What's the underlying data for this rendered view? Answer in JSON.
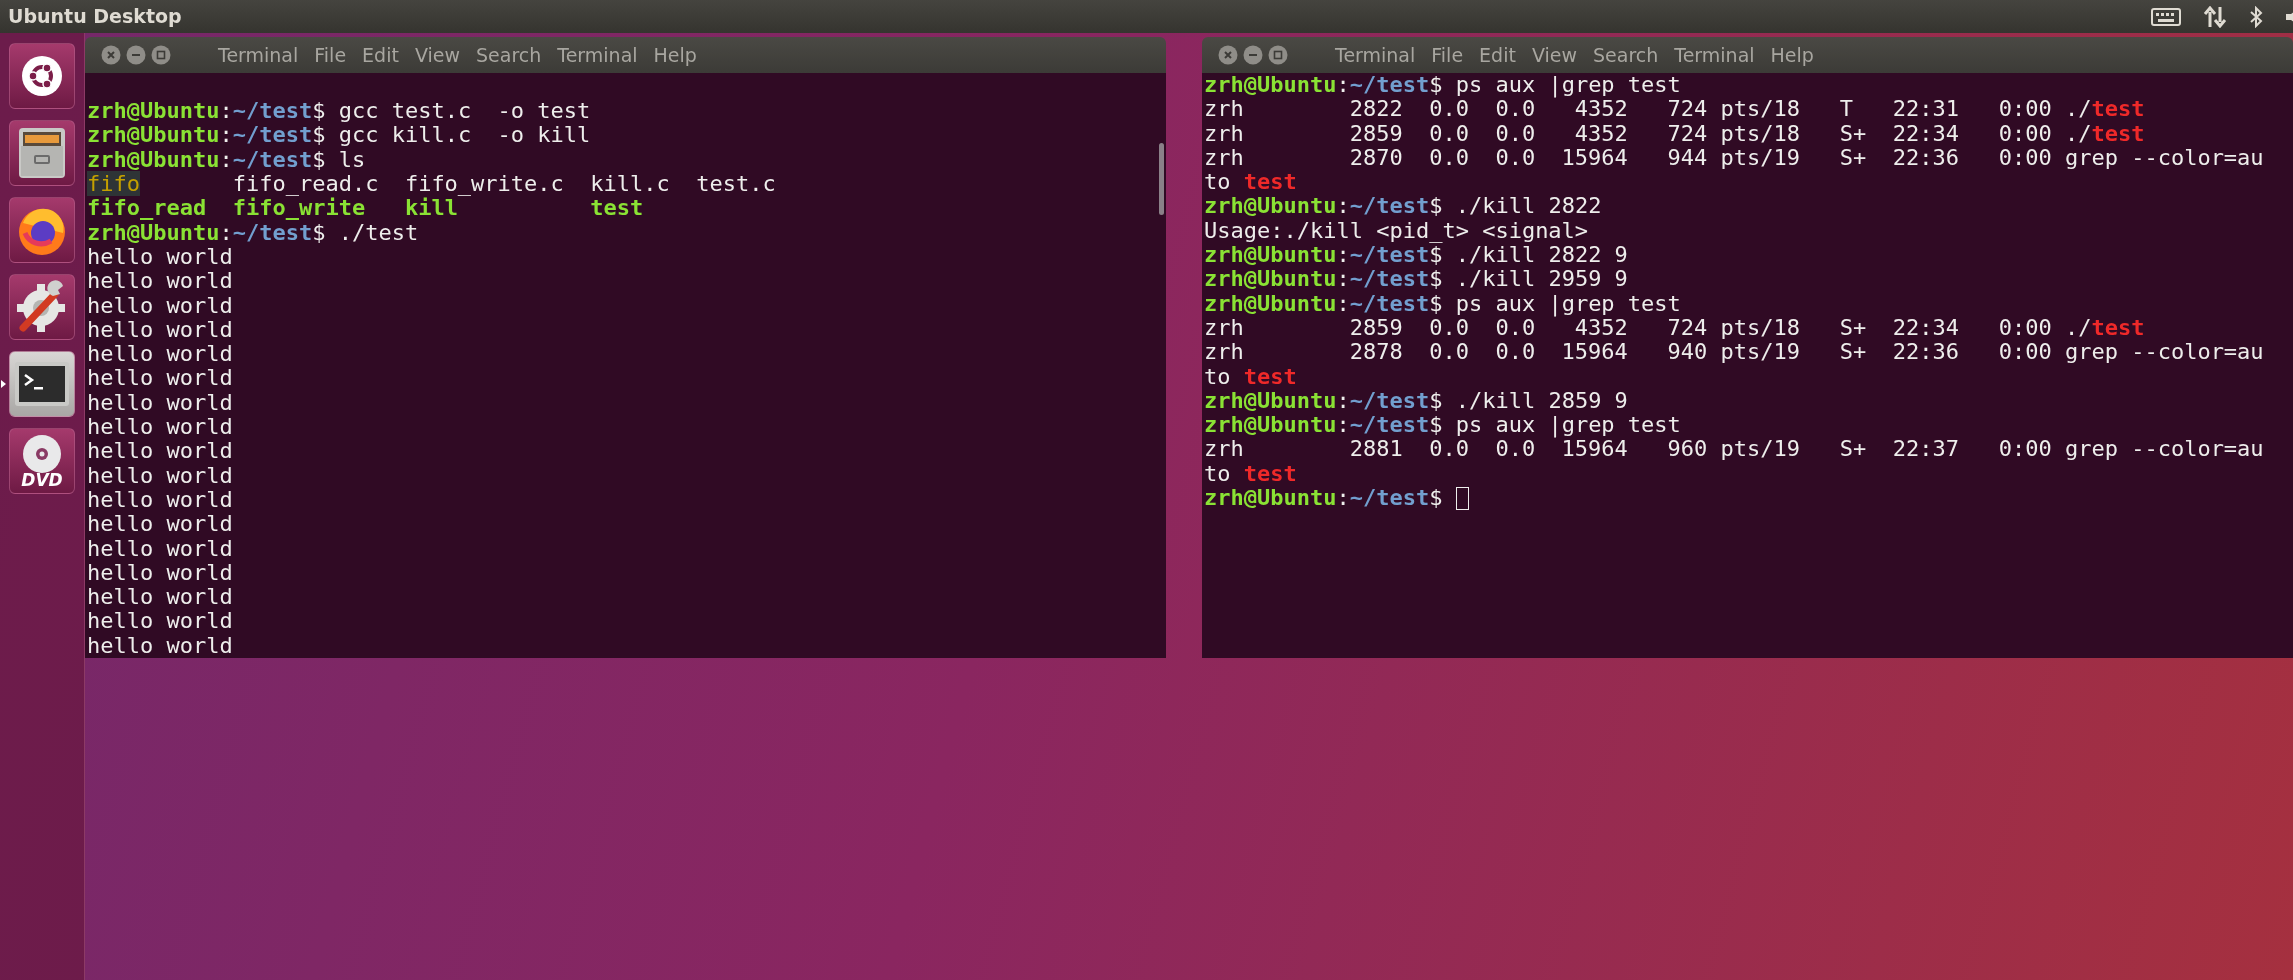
{
  "top_bar": {
    "title": "Ubuntu Desktop",
    "indicators": [
      {
        "kind": "keyboard"
      },
      {
        "kind": "network"
      },
      {
        "kind": "bluetooth"
      },
      {
        "kind": "volume"
      }
    ]
  },
  "launcher": {
    "items": [
      {
        "kind": "home",
        "running": false
      },
      {
        "kind": "files",
        "running": false
      },
      {
        "kind": "browser",
        "running": false
      },
      {
        "kind": "settings",
        "running": false
      },
      {
        "kind": "terminal",
        "running": true
      },
      {
        "kind": "dvd",
        "running": false,
        "label": "DVD"
      }
    ]
  },
  "windows": [
    {
      "menu": [
        "Terminal",
        "File",
        "Edit",
        "View",
        "Search",
        "Terminal",
        "Help"
      ],
      "scrollbar": true,
      "lines": [
        {
          "cursor": false,
          "segments": [
            {
              "kind": "user",
              "text": "zrh@Ubuntu"
            },
            {
              "kind": "plain",
              "text": ":"
            },
            {
              "kind": "path",
              "text": "~/test"
            },
            {
              "kind": "plain",
              "text": "$ gcc test.c  -o test"
            }
          ]
        },
        {
          "cursor": false,
          "segments": [
            {
              "kind": "user",
              "text": "zrh@Ubuntu"
            },
            {
              "kind": "plain",
              "text": ":"
            },
            {
              "kind": "path",
              "text": "~/test"
            },
            {
              "kind": "plain",
              "text": "$ gcc kill.c  -o kill"
            }
          ]
        },
        {
          "cursor": false,
          "segments": [
            {
              "kind": "user",
              "text": "zrh@Ubuntu"
            },
            {
              "kind": "plain",
              "text": ":"
            },
            {
              "kind": "path",
              "text": "~/test"
            },
            {
              "kind": "plain",
              "text": "$ ls"
            }
          ]
        },
        {
          "cursor": false,
          "segments": [
            {
              "kind": "pipe",
              "text": "fifo"
            },
            {
              "kind": "plain",
              "text": "       fifo_read.c  fifo_write.c  kill.c  test.c"
            }
          ]
        },
        {
          "cursor": false,
          "segments": [
            {
              "kind": "exec",
              "text": "fifo_read  "
            },
            {
              "kind": "exec",
              "text": "fifo_write   "
            },
            {
              "kind": "exec",
              "text": "kill          "
            },
            {
              "kind": "exec",
              "text": "test"
            }
          ]
        },
        {
          "cursor": false,
          "segments": [
            {
              "kind": "user",
              "text": "zrh@Ubuntu"
            },
            {
              "kind": "plain",
              "text": ":"
            },
            {
              "kind": "path",
              "text": "~/test"
            },
            {
              "kind": "plain",
              "text": "$ ./test"
            }
          ]
        },
        {
          "cursor": false,
          "segments": [
            {
              "kind": "plain",
              "text": "hello world"
            }
          ]
        },
        {
          "cursor": false,
          "segments": [
            {
              "kind": "plain",
              "text": "hello world"
            }
          ]
        },
        {
          "cursor": false,
          "segments": [
            {
              "kind": "plain",
              "text": "hello world"
            }
          ]
        },
        {
          "cursor": false,
          "segments": [
            {
              "kind": "plain",
              "text": "hello world"
            }
          ]
        },
        {
          "cursor": false,
          "segments": [
            {
              "kind": "plain",
              "text": "hello world"
            }
          ]
        },
        {
          "cursor": false,
          "segments": [
            {
              "kind": "plain",
              "text": "hello world"
            }
          ]
        },
        {
          "cursor": false,
          "segments": [
            {
              "kind": "plain",
              "text": "hello world"
            }
          ]
        },
        {
          "cursor": false,
          "segments": [
            {
              "kind": "plain",
              "text": "hello world"
            }
          ]
        },
        {
          "cursor": false,
          "segments": [
            {
              "kind": "plain",
              "text": "hello world"
            }
          ]
        },
        {
          "cursor": false,
          "segments": [
            {
              "kind": "plain",
              "text": "hello world"
            }
          ]
        },
        {
          "cursor": false,
          "segments": [
            {
              "kind": "plain",
              "text": "hello world"
            }
          ]
        },
        {
          "cursor": false,
          "segments": [
            {
              "kind": "plain",
              "text": "hello world"
            }
          ]
        },
        {
          "cursor": false,
          "segments": [
            {
              "kind": "plain",
              "text": "hello world"
            }
          ]
        },
        {
          "cursor": false,
          "segments": [
            {
              "kind": "plain",
              "text": "hello world"
            }
          ]
        },
        {
          "cursor": false,
          "segments": [
            {
              "kind": "plain",
              "text": "hello world"
            }
          ]
        },
        {
          "cursor": false,
          "segments": [
            {
              "kind": "plain",
              "text": "hello world"
            }
          ]
        },
        {
          "cursor": false,
          "segments": [
            {
              "kind": "plain",
              "text": "hello world"
            }
          ]
        }
      ]
    },
    {
      "menu": [
        "Terminal",
        "File",
        "Edit",
        "View",
        "Search",
        "Terminal",
        "Help"
      ],
      "scrollbar": false,
      "lines": [
        {
          "cursor": false,
          "segments": [
            {
              "kind": "user",
              "text": "zrh@Ubuntu"
            },
            {
              "kind": "plain",
              "text": ":"
            },
            {
              "kind": "path",
              "text": "~/test"
            },
            {
              "kind": "plain",
              "text": "$ ps aux |grep test"
            }
          ]
        },
        {
          "cursor": false,
          "segments": [
            {
              "kind": "plain",
              "text": "zrh        2822  0.0  0.0   4352   724 pts/18   T   22:31   0:00 ./"
            },
            {
              "kind": "match",
              "text": "test"
            }
          ]
        },
        {
          "cursor": false,
          "segments": [
            {
              "kind": "plain",
              "text": "zrh        2859  0.0  0.0   4352   724 pts/18   S+  22:34   0:00 ./"
            },
            {
              "kind": "match",
              "text": "test"
            }
          ]
        },
        {
          "cursor": false,
          "segments": [
            {
              "kind": "plain",
              "text": "zrh        2870  0.0  0.0  15964   944 pts/19   S+  22:36   0:00 grep --color=au"
            }
          ]
        },
        {
          "cursor": false,
          "segments": [
            {
              "kind": "plain",
              "text": "to "
            },
            {
              "kind": "match",
              "text": "test"
            }
          ]
        },
        {
          "cursor": false,
          "segments": [
            {
              "kind": "user",
              "text": "zrh@Ubuntu"
            },
            {
              "kind": "plain",
              "text": ":"
            },
            {
              "kind": "path",
              "text": "~/test"
            },
            {
              "kind": "plain",
              "text": "$ ./kill 2822"
            }
          ]
        },
        {
          "cursor": false,
          "segments": [
            {
              "kind": "plain",
              "text": "Usage:./kill <pid_t> <signal>"
            }
          ]
        },
        {
          "cursor": false,
          "segments": [
            {
              "kind": "user",
              "text": "zrh@Ubuntu"
            },
            {
              "kind": "plain",
              "text": ":"
            },
            {
              "kind": "path",
              "text": "~/test"
            },
            {
              "kind": "plain",
              "text": "$ ./kill 2822 9"
            }
          ]
        },
        {
          "cursor": false,
          "segments": [
            {
              "kind": "user",
              "text": "zrh@Ubuntu"
            },
            {
              "kind": "plain",
              "text": ":"
            },
            {
              "kind": "path",
              "text": "~/test"
            },
            {
              "kind": "plain",
              "text": "$ ./kill 2959 9"
            }
          ]
        },
        {
          "cursor": false,
          "segments": [
            {
              "kind": "user",
              "text": "zrh@Ubuntu"
            },
            {
              "kind": "plain",
              "text": ":"
            },
            {
              "kind": "path",
              "text": "~/test"
            },
            {
              "kind": "plain",
              "text": "$ ps aux |grep test"
            }
          ]
        },
        {
          "cursor": false,
          "segments": [
            {
              "kind": "plain",
              "text": "zrh        2859  0.0  0.0   4352   724 pts/18   S+  22:34   0:00 ./"
            },
            {
              "kind": "match",
              "text": "test"
            }
          ]
        },
        {
          "cursor": false,
          "segments": [
            {
              "kind": "plain",
              "text": "zrh        2878  0.0  0.0  15964   940 pts/19   S+  22:36   0:00 grep --color=au"
            }
          ]
        },
        {
          "cursor": false,
          "segments": [
            {
              "kind": "plain",
              "text": "to "
            },
            {
              "kind": "match",
              "text": "test"
            }
          ]
        },
        {
          "cursor": false,
          "segments": [
            {
              "kind": "user",
              "text": "zrh@Ubuntu"
            },
            {
              "kind": "plain",
              "text": ":"
            },
            {
              "kind": "path",
              "text": "~/test"
            },
            {
              "kind": "plain",
              "text": "$ ./kill 2859 9"
            }
          ]
        },
        {
          "cursor": false,
          "segments": [
            {
              "kind": "user",
              "text": "zrh@Ubuntu"
            },
            {
              "kind": "plain",
              "text": ":"
            },
            {
              "kind": "path",
              "text": "~/test"
            },
            {
              "kind": "plain",
              "text": "$ ps aux |grep test"
            }
          ]
        },
        {
          "cursor": false,
          "segments": [
            {
              "kind": "plain",
              "text": "zrh        2881  0.0  0.0  15964   960 pts/19   S+  22:37   0:00 grep --color=au"
            }
          ]
        },
        {
          "cursor": false,
          "segments": [
            {
              "kind": "plain",
              "text": "to "
            },
            {
              "kind": "match",
              "text": "test"
            }
          ]
        },
        {
          "cursor": true,
          "segments": [
            {
              "kind": "user",
              "text": "zrh@Ubuntu"
            },
            {
              "kind": "plain",
              "text": ":"
            },
            {
              "kind": "path",
              "text": "~/test"
            },
            {
              "kind": "plain",
              "text": "$ "
            }
          ]
        }
      ]
    }
  ]
}
